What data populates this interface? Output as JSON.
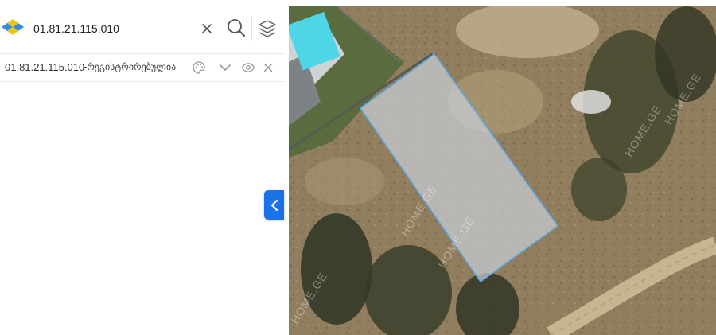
{
  "search": {
    "value": "01.81.21.115.010",
    "placeholder": ""
  },
  "result": {
    "cadastral_code": "01.81.21.115.010",
    "status": "-რეგისტრირებულია"
  },
  "map": {
    "watermark": "HOME.GE",
    "parcel_fill": "#c9cdd6",
    "parcel_stroke": "#5aa9e6"
  },
  "colors": {
    "accent": "#1a73e8",
    "logo_blue": "#2f8fdb",
    "logo_yellow": "#f4c20d"
  },
  "icons": {
    "logo": "logo-icon",
    "clear": "close-icon",
    "search": "search-icon",
    "layers": "layers-icon",
    "palette": "palette-icon",
    "expand": "chevron-down-icon",
    "visibility": "eye-icon",
    "remove": "close-icon",
    "collapse": "chevron-left-icon"
  }
}
